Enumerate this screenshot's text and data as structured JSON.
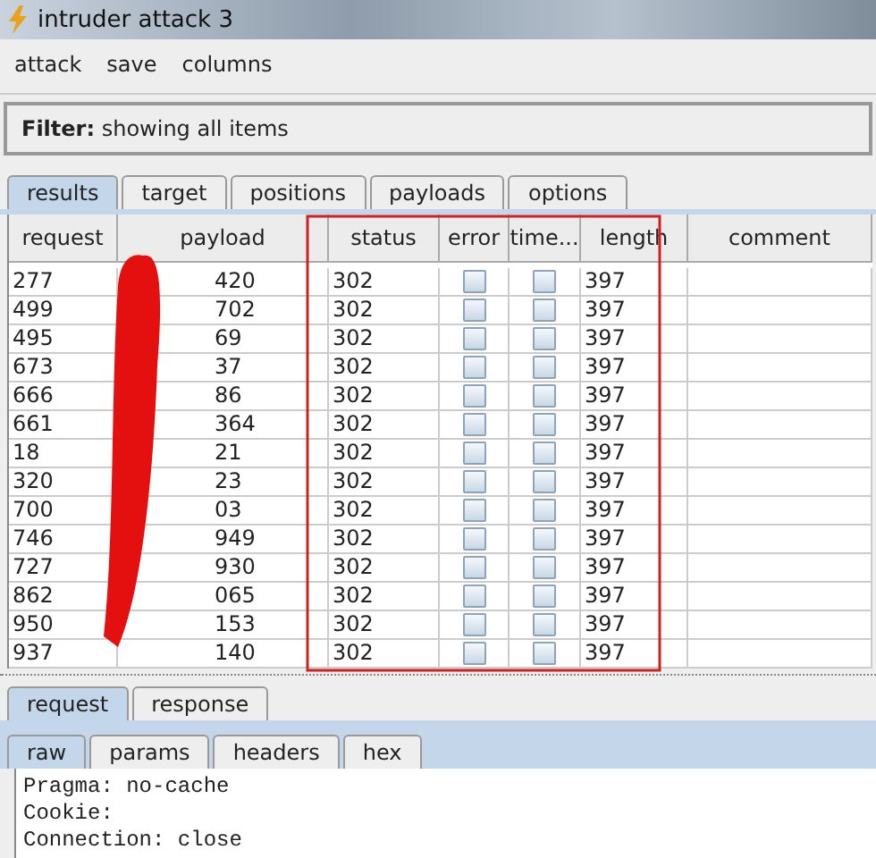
{
  "window": {
    "title": "intruder attack 3"
  },
  "menu": [
    "attack",
    "save",
    "columns"
  ],
  "filter": {
    "label": "Filter:",
    "value": "showing all items"
  },
  "tabs": [
    {
      "label": "results",
      "selected": true
    },
    {
      "label": "target",
      "selected": false
    },
    {
      "label": "positions",
      "selected": false
    },
    {
      "label": "payloads",
      "selected": false
    },
    {
      "label": "options",
      "selected": false
    }
  ],
  "table": {
    "columns": [
      "request",
      "payload",
      "status",
      "error",
      "time...",
      "length",
      "comment"
    ],
    "rows": [
      {
        "request": "277",
        "payload": "420",
        "status": "302",
        "error": false,
        "timeout": false,
        "length": "397"
      },
      {
        "request": "499",
        "payload": "702",
        "status": "302",
        "error": false,
        "timeout": false,
        "length": "397"
      },
      {
        "request": "495",
        "payload": "69",
        "status": "302",
        "error": false,
        "timeout": false,
        "length": "397"
      },
      {
        "request": "673",
        "payload": "37",
        "status": "302",
        "error": false,
        "timeout": false,
        "length": "397"
      },
      {
        "request": "666",
        "payload": "86",
        "status": "302",
        "error": false,
        "timeout": false,
        "length": "397"
      },
      {
        "request": "661",
        "payload": "364",
        "status": "302",
        "error": false,
        "timeout": false,
        "length": "397"
      },
      {
        "request": "18",
        "payload": "21",
        "status": "302",
        "error": false,
        "timeout": false,
        "length": "397"
      },
      {
        "request": "320",
        "payload": "23",
        "status": "302",
        "error": false,
        "timeout": false,
        "length": "397"
      },
      {
        "request": "700",
        "payload": "03",
        "status": "302",
        "error": false,
        "timeout": false,
        "length": "397"
      },
      {
        "request": "746",
        "payload": "949",
        "status": "302",
        "error": false,
        "timeout": false,
        "length": "397"
      },
      {
        "request": "727",
        "payload": "930",
        "status": "302",
        "error": false,
        "timeout": false,
        "length": "397"
      },
      {
        "request": "862",
        "payload": "065",
        "status": "302",
        "error": false,
        "timeout": false,
        "length": "397"
      },
      {
        "request": "950",
        "payload": "153",
        "status": "302",
        "error": false,
        "timeout": false,
        "length": "397"
      },
      {
        "request": "937",
        "payload": "140",
        "status": "302",
        "error": false,
        "timeout": false,
        "length": "397"
      }
    ]
  },
  "message_tabs": [
    {
      "label": "request",
      "selected": true
    },
    {
      "label": "response",
      "selected": false
    }
  ],
  "view_tabs": [
    {
      "label": "raw",
      "selected": true
    },
    {
      "label": "params",
      "selected": false
    },
    {
      "label": "headers",
      "selected": false
    },
    {
      "label": "hex",
      "selected": false
    }
  ],
  "message_lines": [
    "Pragma: no-cache",
    "Cookie:",
    "Connection: close"
  ]
}
